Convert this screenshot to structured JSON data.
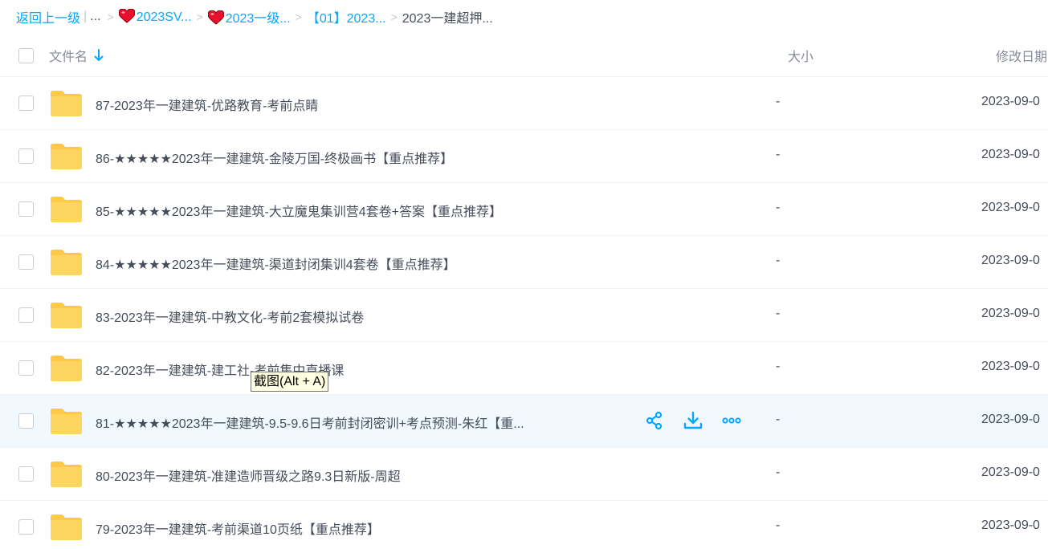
{
  "breadcrumb": {
    "back": "返回上一级",
    "separator": "|",
    "ellipsis": "...",
    "items": [
      {
        "label": "2023SV...",
        "icon": "heart-icon"
      },
      {
        "label": "2023一级...",
        "icon": "heart-icon"
      },
      {
        "label": "【01】2023..."
      }
    ],
    "current": "2023一建超押..."
  },
  "header": {
    "name": "文件名",
    "size": "大小",
    "date": "修改日期"
  },
  "rows": [
    {
      "name": "87-2023年一建建筑-优路教育-考前点睛",
      "size": "-",
      "date": "2023-09-0"
    },
    {
      "name": "86-★★★★★2023年一建建筑-金陵万国-终极画书【重点推荐】",
      "size": "-",
      "date": "2023-09-0"
    },
    {
      "name": "85-★★★★★2023年一建建筑-大立魔鬼集训营4套卷+答案【重点推荐】",
      "size": "-",
      "date": "2023-09-0"
    },
    {
      "name": "84-★★★★★2023年一建建筑-渠道封闭集训4套卷【重点推荐】",
      "size": "-",
      "date": "2023-09-0"
    },
    {
      "name": "83-2023年一建建筑-中教文化-考前2套模拟试卷",
      "size": "-",
      "date": "2023-09-0"
    },
    {
      "name": "82-2023年一建建筑-建工社-考前集中直播课",
      "size": "-",
      "date": "2023-09-0"
    },
    {
      "name": "81-★★★★★2023年一建建筑-9.5-9.6日考前封闭密训+考点预测-朱红【重...",
      "size": "-",
      "date": "2023-09-0"
    },
    {
      "name": "80-2023年一建建筑-准建造师晋级之路9.3日新版-周超",
      "size": "-",
      "date": "2023-09-0"
    },
    {
      "name": "79-2023年一建建筑-考前渠道10页纸【重点推荐】",
      "size": "-",
      "date": "2023-09-0"
    }
  ],
  "tooltip": "截图(Alt + A)",
  "colors": {
    "accent": "#06a7ff",
    "folder": "#ffd15c",
    "hover_row": "#f1f8fe"
  }
}
